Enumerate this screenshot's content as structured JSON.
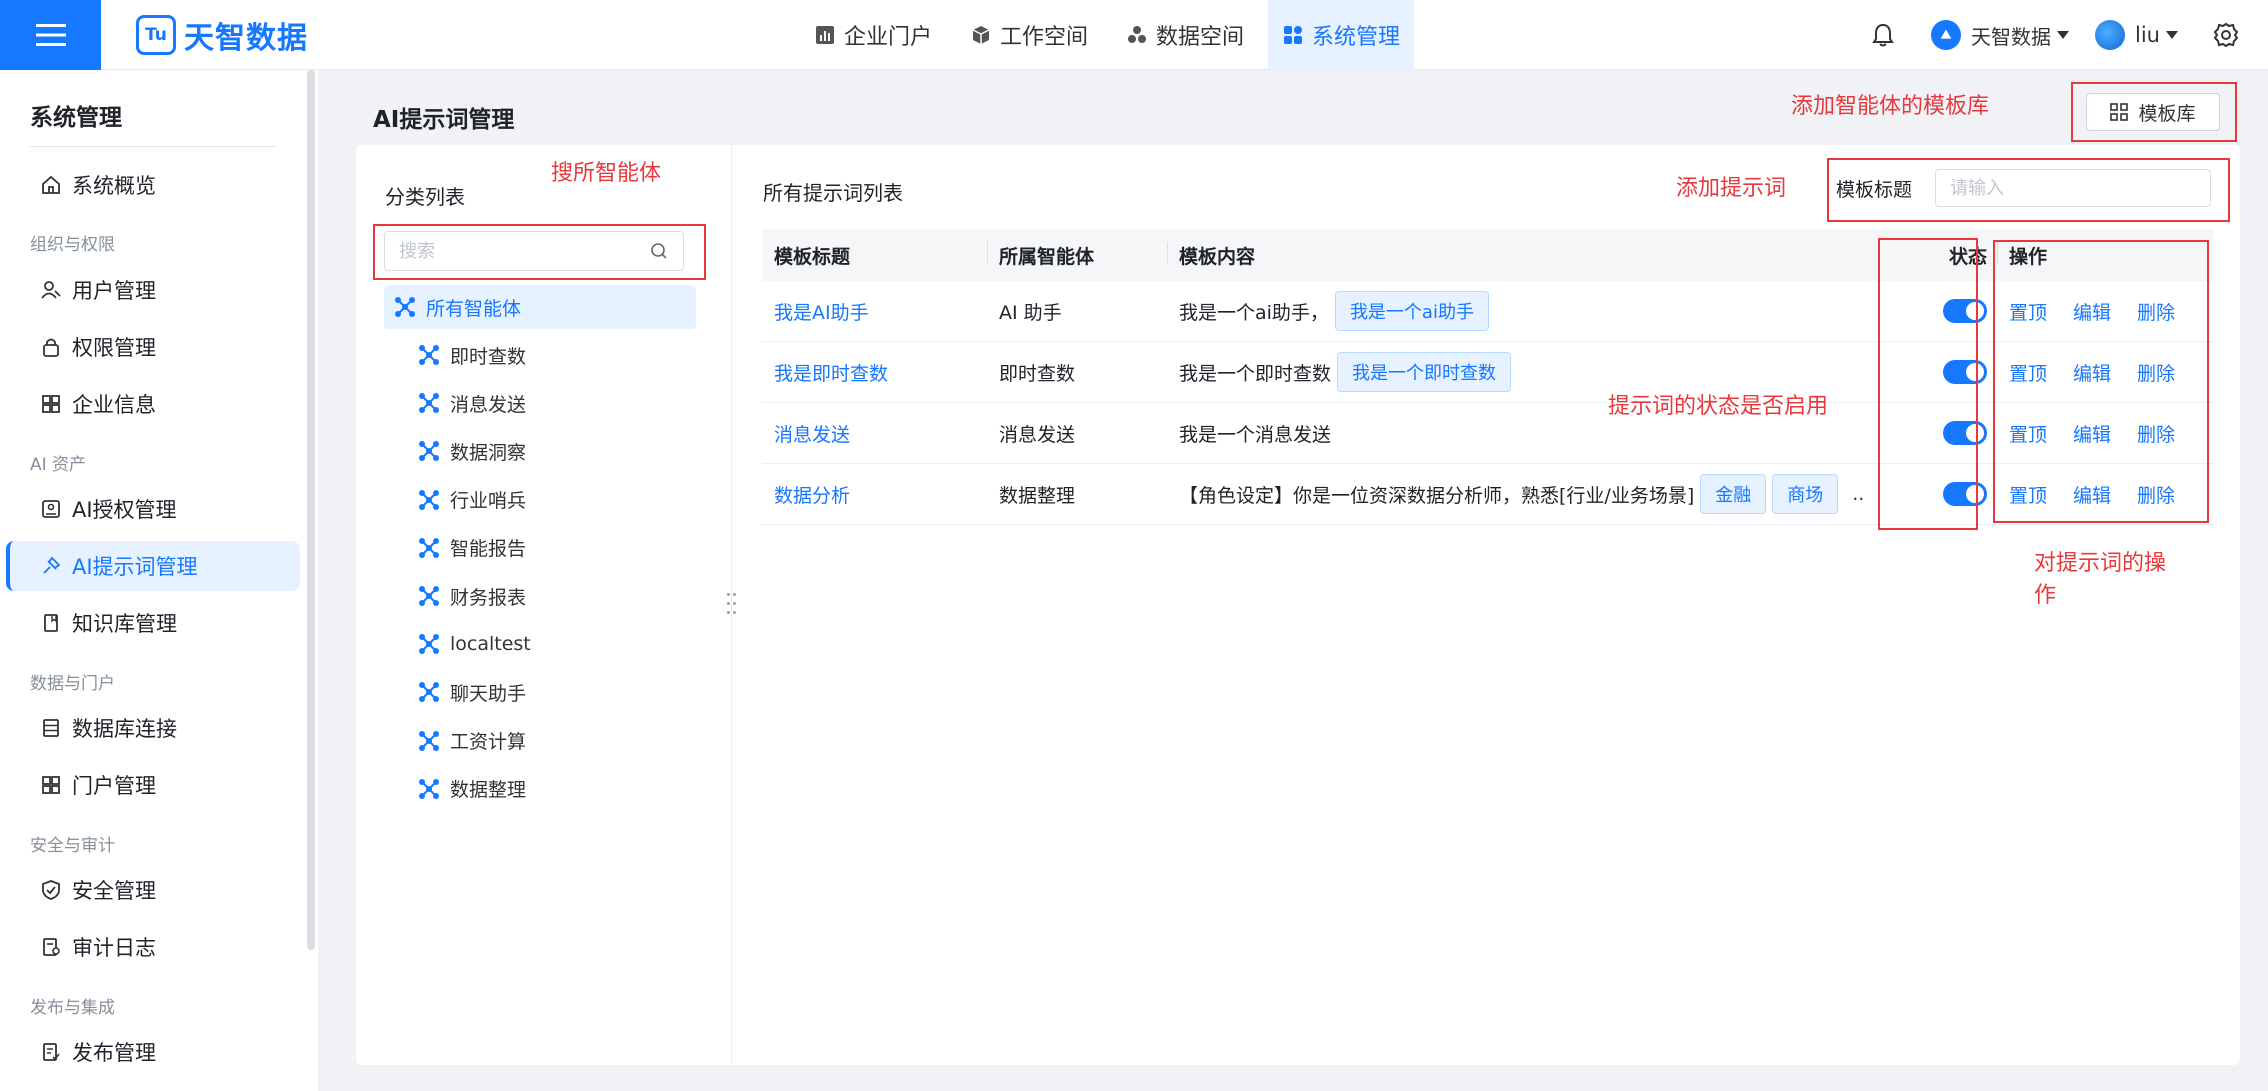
{
  "app": {
    "logo_badge": "Tu",
    "logo_text": "天智数据"
  },
  "top_nav": [
    {
      "label": "企业门户",
      "icon": "bar-chart-icon"
    },
    {
      "label": "工作空间",
      "icon": "cube-icon"
    },
    {
      "label": "数据空间",
      "icon": "cubes-icon"
    },
    {
      "label": "系统管理",
      "icon": "grid-icon",
      "active": true
    }
  ],
  "top_right": {
    "org_name": "天智数据",
    "user_name": "liu"
  },
  "sidebar": {
    "title": "系统管理",
    "groups": {
      "org": "组织与权限",
      "ai": "AI 资产",
      "data": "数据与门户",
      "security": "安全与审计",
      "publish": "发布与集成"
    },
    "items": [
      {
        "label": "系统概览",
        "icon": "home-icon"
      },
      {
        "label": "用户管理",
        "icon": "user-icon"
      },
      {
        "label": "权限管理",
        "icon": "lock-icon"
      },
      {
        "label": "企业信息",
        "icon": "apps-icon"
      },
      {
        "label": "AI授权管理",
        "icon": "license-icon"
      },
      {
        "label": "AI提示词管理",
        "icon": "prompt-icon",
        "active": true
      },
      {
        "label": "知识库管理",
        "icon": "book-icon"
      },
      {
        "label": "数据库连接",
        "icon": "database-icon"
      },
      {
        "label": "门户管理",
        "icon": "apps-icon"
      },
      {
        "label": "安全管理",
        "icon": "shield-icon"
      },
      {
        "label": "审计日志",
        "icon": "audit-icon"
      },
      {
        "label": "发布管理",
        "icon": "publish-icon"
      }
    ]
  },
  "page": {
    "title": "AI提示词管理",
    "template_button": "模板库"
  },
  "category": {
    "title": "分类列表",
    "search_placeholder": "搜索",
    "root": "所有智能体",
    "items": [
      "即时查数",
      "消息发送",
      "数据洞察",
      "行业哨兵",
      "智能报告",
      "财务报表",
      "localtest",
      "聊天助手",
      "工资计算",
      "数据整理"
    ]
  },
  "prompts": {
    "title": "所有提示词列表",
    "filter_label": "模板标题",
    "filter_placeholder": "请输入",
    "columns": {
      "title": "模板标题",
      "agent": "所属智能体",
      "content": "模板内容",
      "status": "状态",
      "ops": "操作"
    },
    "ops": {
      "pin": "置顶",
      "edit": "编辑",
      "delete": "删除"
    },
    "rows": [
      {
        "title": "我是AI助手",
        "agent": "AI 助手",
        "content": "我是一个ai助手，",
        "tags": [
          "我是一个ai助手"
        ],
        "more": "",
        "enabled": true
      },
      {
        "title": "我是即时查数",
        "agent": "即时查数",
        "content": "我是一个即时查数",
        "tags": [
          "我是一个即时查数"
        ],
        "more": "",
        "enabled": true
      },
      {
        "title": "消息发送",
        "agent": "消息发送",
        "content": "我是一个消息发送",
        "tags": [],
        "more": "",
        "enabled": true
      },
      {
        "title": "数据分析",
        "agent": "数据整理",
        "content": "【角色设定】你是一位资深数据分析师，熟悉[行业/业务场景]",
        "tags": [
          "金融",
          "商场"
        ],
        "more": "..",
        "enabled": true
      }
    ]
  },
  "annotations": {
    "search": "搜所智能体",
    "add_template": "添加智能体的模板库",
    "add_prompt": "添加提示词",
    "status": "提示词的状态是否启用",
    "ops_line1": "对提示词的操",
    "ops_line2": "作"
  },
  "colors": {
    "accent": "#1677ff",
    "annotation": "#e8383d"
  }
}
